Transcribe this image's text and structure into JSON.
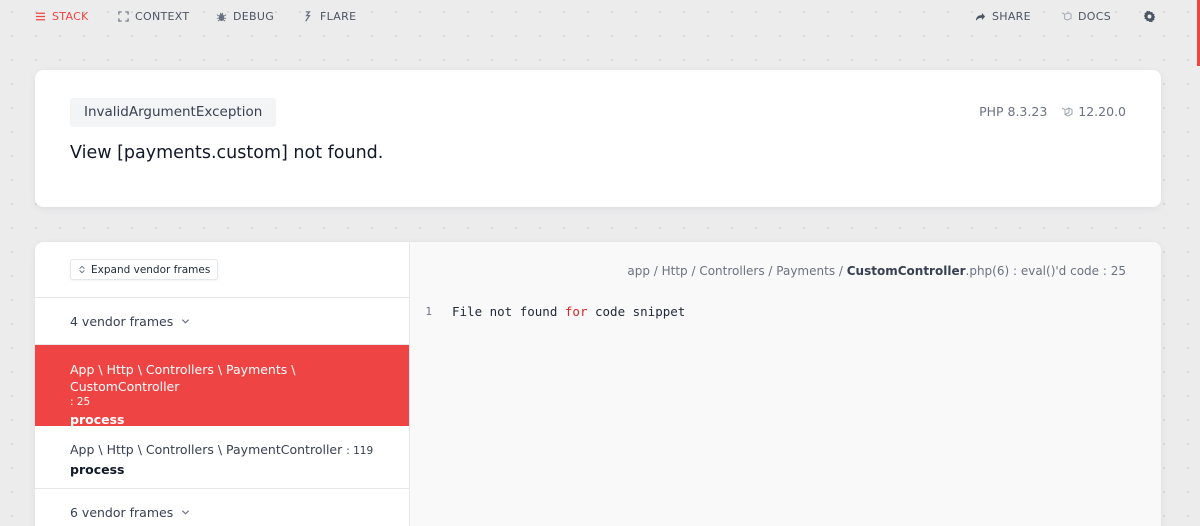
{
  "nav": {
    "stack": "STACK",
    "context": "CONTEXT",
    "debug": "DEBUG",
    "flare": "FLARE",
    "share": "SHARE",
    "docs": "DOCS"
  },
  "header": {
    "exception_class": "InvalidArgumentException",
    "message": "View [payments.custom] not found.",
    "php_version": "PHP 8.3.23",
    "laravel_version": "12.20.0"
  },
  "frames": {
    "expand_label": "Expand vendor frames",
    "vendor_group_1": "4 vendor frames",
    "active_frame": {
      "class": "App \\ Http \\ Controllers \\ Payments \\ CustomController",
      "line": ": 25",
      "method": "process"
    },
    "frame_2": {
      "class": "App \\ Http \\ Controllers \\ PaymentController",
      "line": ": 119",
      "method": "process"
    },
    "vendor_group_2": "6 vendor frames"
  },
  "code": {
    "path_prefix": "app / Http / Controllers / Payments / ",
    "path_file": "CustomController",
    "path_suffix": ".php(6) : eval()'d code : 25",
    "line_number": "1",
    "text_before": "File not found ",
    "keyword": "for",
    "text_after": " code snippet"
  },
  "colors": {
    "accent": "#ef4444"
  }
}
